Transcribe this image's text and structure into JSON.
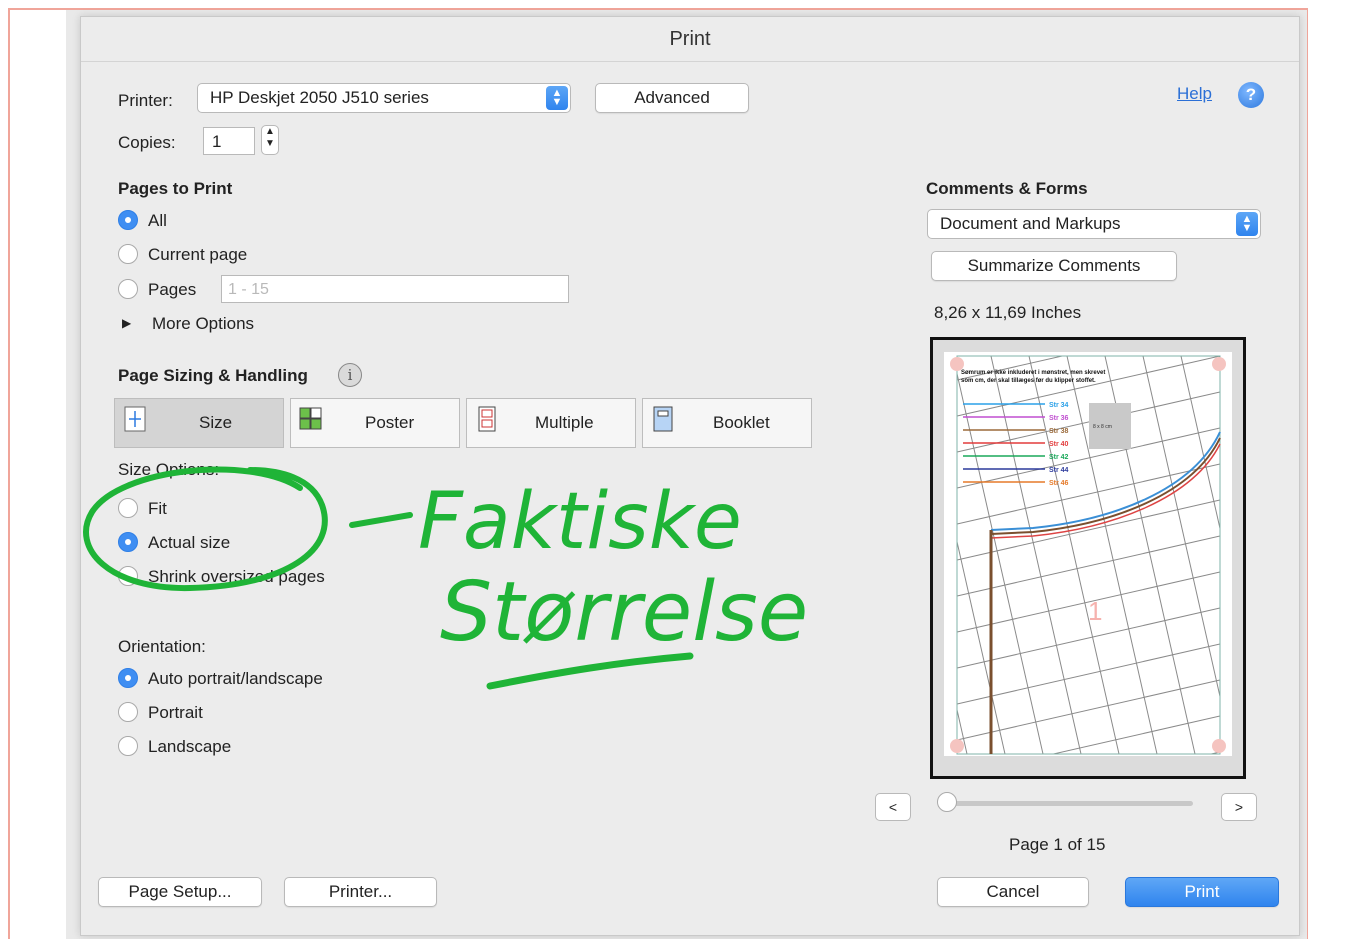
{
  "window": {
    "title": "Print"
  },
  "printer": {
    "label": "Printer:",
    "value": "HP Deskjet 2050 J510 series",
    "advanced_label": "Advanced"
  },
  "copies": {
    "label": "Copies:",
    "value": "1"
  },
  "help": {
    "label": "Help",
    "icon": "?"
  },
  "pages_to_print": {
    "heading": "Pages to Print",
    "all_label": "All",
    "current_label": "Current page",
    "pages_label": "Pages",
    "pages_placeholder": "1 - 15",
    "more_options_label": "More Options"
  },
  "sizing": {
    "heading": "Page Sizing & Handling",
    "info_icon": "i",
    "tabs": [
      {
        "label": "Size"
      },
      {
        "label": "Poster"
      },
      {
        "label": "Multiple"
      },
      {
        "label": "Booklet"
      }
    ],
    "size_options_label": "Size Options:",
    "fit_label": "Fit",
    "actual_label": "Actual size",
    "shrink_label": "Shrink oversized pages"
  },
  "orientation": {
    "heading": "Orientation:",
    "auto_label": "Auto portrait/landscape",
    "portrait_label": "Portrait",
    "landscape_label": "Landscape"
  },
  "comments": {
    "heading": "Comments & Forms",
    "value": "Document and Markups",
    "summarize_label": "Summarize Comments"
  },
  "preview": {
    "size_text": "8,26 x 11,69 Inches",
    "doc_text_line1": "Sømrum er ikke inkluderet i mønstret, men skrevet",
    "doc_text_line2": "som cm, der skal tillæges før du klipper stoffet.",
    "sizes": [
      "Str 34",
      "Str 36",
      "Str 38",
      "Str 40",
      "Str 42",
      "Str 44",
      "Str 46"
    ],
    "size_colors": [
      "#2aa0e8",
      "#c04fd0",
      "#9b6a3a",
      "#e23c3c",
      "#1aa85a",
      "#2c3a9c",
      "#e57a2a"
    ],
    "box_label": "8 x 8 cm",
    "page_number_mark": "1",
    "prev_label": "<",
    "next_label": ">",
    "page_text": "Page 1 of 15"
  },
  "footer": {
    "page_setup_label": "Page Setup...",
    "printer_label": "Printer...",
    "cancel_label": "Cancel",
    "print_label": "Print"
  },
  "annotation": {
    "line1": "Faktiske",
    "line2": "Størrelse",
    "color": "#1fb437"
  }
}
